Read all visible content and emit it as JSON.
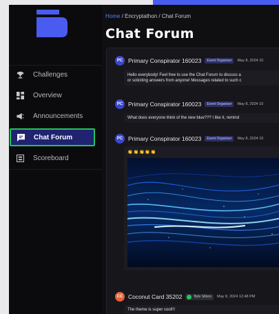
{
  "sidebar": {
    "items": [
      {
        "label": "Challenges",
        "icon": "trophy-icon"
      },
      {
        "label": "Overview",
        "icon": "grid-icon"
      },
      {
        "label": "Announcements",
        "icon": "megaphone-icon"
      },
      {
        "label": "Chat Forum",
        "icon": "chat-icon",
        "active": true
      },
      {
        "label": "Scoreboard",
        "icon": "scoreboard-icon"
      }
    ]
  },
  "breadcrumb": {
    "home": "Home",
    "rest": " / Encryptathon / Chat Forum"
  },
  "page": {
    "title": "Chat Forum"
  },
  "posts": [
    {
      "avatar": "PC",
      "avatar_color": "#3b46c9",
      "author": "Primary Conspirator 160023",
      "badge": "Event Organiser",
      "time": "May 8, 2024 10",
      "body_line1": "Hello everybody! Feel free to use the Chat Forum to discuss a",
      "body_line2": "or soliciting answers from anyone! Messages related to such c"
    },
    {
      "avatar": "PC",
      "avatar_color": "#3b46c9",
      "author": "Primary Conspirator 160023",
      "badge": "Event Organiser",
      "time": "May 8, 2024 10",
      "body_line1": "What does everyone think of the new blue??? I like it, remind"
    },
    {
      "avatar": "PC",
      "avatar_color": "#3b46c9",
      "author": "Primary Conspirator 160023",
      "badge": "Event Organiser",
      "time": "May 8, 2024 10",
      "emoji": "👏👏👏👏👏"
    },
    {
      "avatar": "CC",
      "avatar_color": "#e0623a",
      "author": "Coconut Card 35202",
      "badge": "Byte Sitters",
      "time": "May 8, 2024 12:48 PM",
      "body_line1": "The theme is super cool!!!"
    }
  ],
  "colors": {
    "accent": "#4a5cf0",
    "active_border": "#22c55e",
    "active_bg": "#1f2370"
  }
}
